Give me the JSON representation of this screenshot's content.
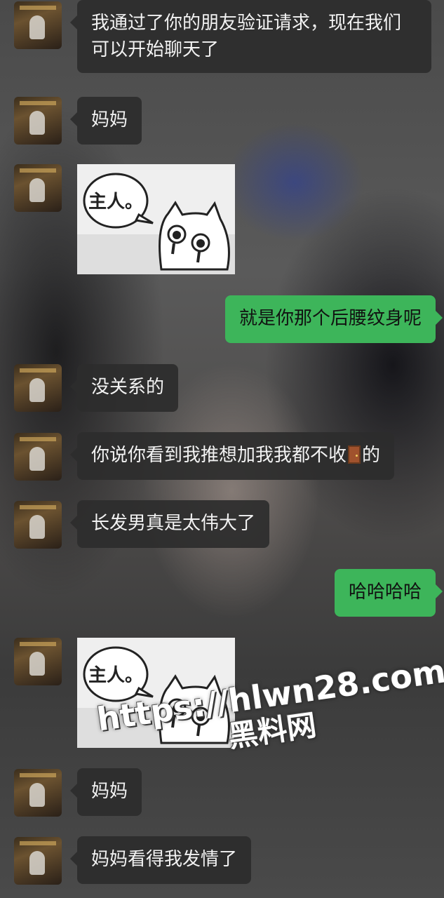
{
  "messages": [
    {
      "side": "left",
      "type": "text",
      "text": "我通过了你的朋友验证请求，现在我们可以开始聊天了"
    },
    {
      "side": "left",
      "type": "text",
      "text": "妈妈"
    },
    {
      "side": "left",
      "type": "sticker",
      "sticker_text": "主人。"
    },
    {
      "side": "right",
      "type": "text",
      "text": "就是你那个后腰纹身呢"
    },
    {
      "side": "left",
      "type": "text",
      "text": "没关系的"
    },
    {
      "side": "left",
      "type": "text",
      "text_before": "你说你看到我推想加我我都不收",
      "emoji": "door-emoji",
      "text_after": "的"
    },
    {
      "side": "left",
      "type": "text",
      "text": "长发男真是太伟大了"
    },
    {
      "side": "right",
      "type": "text",
      "text": "哈哈哈哈"
    },
    {
      "side": "left",
      "type": "sticker",
      "sticker_text": "主人。"
    },
    {
      "side": "left",
      "type": "text",
      "text": "妈妈"
    },
    {
      "side": "left",
      "type": "text",
      "text": "妈妈看得我发情了"
    }
  ],
  "watermark": {
    "url": "https://hlwn28.com",
    "name": "黑料网"
  },
  "colors": {
    "left_bubble": "#2c2c2c",
    "right_bubble": "#3db55a",
    "left_text": "#f2f2f2",
    "right_text": "#111111"
  }
}
